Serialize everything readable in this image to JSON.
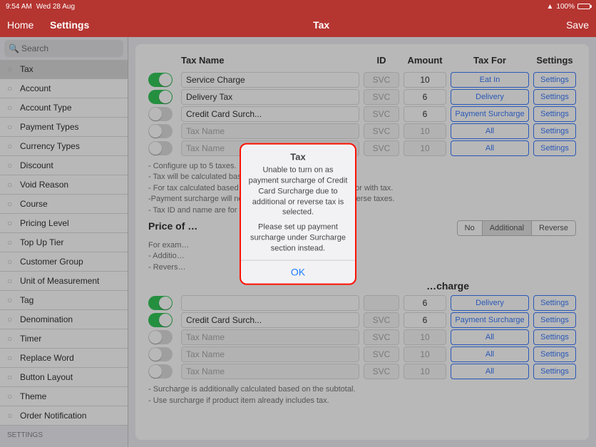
{
  "status": {
    "time": "9:54 AM",
    "date": "Wed 28 Aug",
    "battery": "100%"
  },
  "nav": {
    "home": "Home",
    "sidebar_title": "Settings",
    "main_title": "Tax",
    "save": "Save"
  },
  "search": {
    "placeholder": "Search"
  },
  "sidebar": {
    "items": [
      {
        "label": "Tax"
      },
      {
        "label": "Account"
      },
      {
        "label": "Account Type"
      },
      {
        "label": "Payment Types"
      },
      {
        "label": "Currency Types"
      },
      {
        "label": "Discount"
      },
      {
        "label": "Void Reason"
      },
      {
        "label": "Course"
      },
      {
        "label": "Pricing Level"
      },
      {
        "label": "Top Up Tier"
      },
      {
        "label": "Customer Group"
      },
      {
        "label": "Unit of Measurement"
      },
      {
        "label": "Tag"
      },
      {
        "label": "Denomination"
      },
      {
        "label": "Timer"
      },
      {
        "label": "Replace Word"
      },
      {
        "label": "Button Layout"
      },
      {
        "label": "Theme"
      },
      {
        "label": "Order Notification"
      }
    ],
    "section_settings": "Settings"
  },
  "headers": {
    "tax_name": "Tax Name",
    "id": "ID",
    "amount": "Amount",
    "tax_for": "Tax For",
    "settings": "Settings"
  },
  "tax_rows": [
    {
      "on": true,
      "name": "Service Charge",
      "id": "SVC",
      "amount": "10",
      "for": "Eat In",
      "settings": "Settings",
      "ph": false
    },
    {
      "on": true,
      "name": "Delivery Tax",
      "id": "SVC",
      "amount": "6",
      "for": "Delivery",
      "settings": "Settings",
      "ph": false
    },
    {
      "on": false,
      "name": "Credit Card Surch...",
      "id": "SVC",
      "amount": "6",
      "for": "Payment Surcharge",
      "settings": "Settings",
      "ph": false
    },
    {
      "on": false,
      "name": "Tax Name",
      "id": "SVC",
      "amount": "10",
      "for": "All",
      "settings": "Settings",
      "ph": true
    },
    {
      "on": false,
      "name": "Tax Name",
      "id": "SVC",
      "amount": "10",
      "for": "All",
      "settings": "Settings",
      "ph": true
    }
  ],
  "notes1_lines": [
    "- Configure up to 5 taxes.",
    "- Tax will be calculated based on the subtotal.",
    "- For tax calculated based on the subtotal + tax, select yes for with tax.",
    "-Payment surcharge will not be applied to additional and reverse taxes.",
    "- Tax ID and name are for your interface and report."
  ],
  "price_section": {
    "title_partial": "Price of …",
    "seg": {
      "no": "No",
      "additional": "Additional",
      "reverse": "Reverse"
    },
    "example_lines": [
      "For exam…",
      "- Additio…",
      "- Revers…"
    ]
  },
  "surcharge_section": {
    "title_partial": "…charge"
  },
  "surcharge_rows": [
    {
      "on": true,
      "name": "",
      "id": "",
      "amount": "6",
      "for": "Delivery",
      "settings": "Settings",
      "ph": false
    },
    {
      "on": true,
      "name": "Credit Card Surch...",
      "id": "SVC",
      "amount": "6",
      "for": "Payment Surcharge",
      "settings": "Settings",
      "ph": false
    },
    {
      "on": false,
      "name": "Tax Name",
      "id": "SVC",
      "amount": "10",
      "for": "All",
      "settings": "Settings",
      "ph": true
    },
    {
      "on": false,
      "name": "Tax Name",
      "id": "SVC",
      "amount": "10",
      "for": "All",
      "settings": "Settings",
      "ph": true
    },
    {
      "on": false,
      "name": "Tax Name",
      "id": "SVC",
      "amount": "10",
      "for": "All",
      "settings": "Settings",
      "ph": true
    }
  ],
  "notes2_lines": [
    "- Surcharge is additionally calculated based on the subtotal.",
    "- Use surcharge if product item already includes tax."
  ],
  "alert": {
    "title": "Tax",
    "body1": "Unable to turn on as payment surcharge of Credit Card Surcharge due to additional or reverse tax is selected.",
    "body2": "Please set up payment surcharge under Surcharge section instead.",
    "ok": "OK"
  }
}
